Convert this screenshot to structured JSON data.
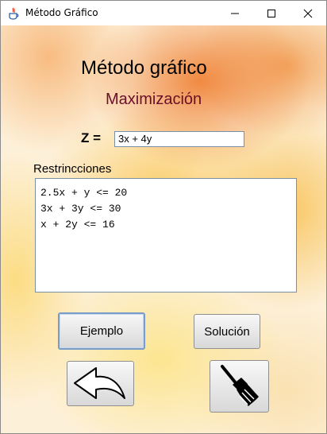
{
  "window": {
    "title": "Método Gráfico"
  },
  "heading": "Método gráfico",
  "subheading": "Maximización",
  "objective": {
    "label": "Z =",
    "value": "3x + 4y"
  },
  "constraints": {
    "label": "Restrincciones",
    "lines": [
      "2.5x + y <= 20",
      "3x + 3y <= 30",
      "x + 2y <= 16"
    ]
  },
  "buttons": {
    "example": "Ejemplo",
    "solution": "Solución"
  },
  "icons": {
    "back": "back-arrow-icon",
    "clear": "broom-icon"
  }
}
